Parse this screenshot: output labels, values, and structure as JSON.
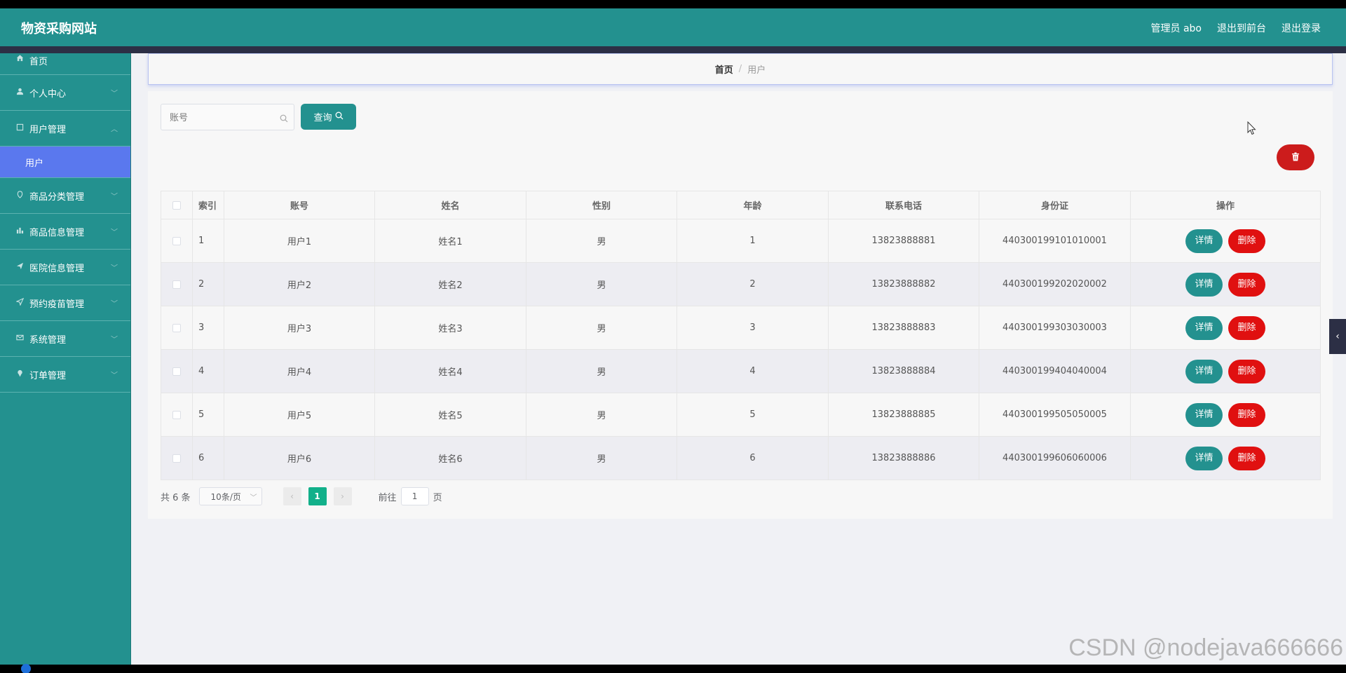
{
  "header": {
    "title": "物资采购网站",
    "admin_label": "管理员 abo",
    "back_front": "退出到前台",
    "logout": "退出登录"
  },
  "sidebar": {
    "items": [
      {
        "label": "首页",
        "icon": "home-icon"
      },
      {
        "label": "个人中心",
        "icon": "user-icon"
      },
      {
        "label": "用户管理",
        "icon": "square-icon",
        "expanded": true,
        "sub": [
          "用户"
        ]
      },
      {
        "label": "商品分类管理",
        "icon": "tag-icon"
      },
      {
        "label": "商品信息管理",
        "icon": "chart-icon"
      },
      {
        "label": "医院信息管理",
        "icon": "send-icon"
      },
      {
        "label": "预约疫苗管理",
        "icon": "location-icon"
      },
      {
        "label": "系统管理",
        "icon": "mail-icon"
      },
      {
        "label": "订单管理",
        "icon": "pin-icon"
      }
    ],
    "active_sub": "用户",
    "active_color": "#5a78ee"
  },
  "breadcrumb": {
    "home": "首页",
    "separator": "/",
    "current": "用户"
  },
  "search": {
    "placeholder": "账号",
    "query_label": "查询"
  },
  "table": {
    "columns": [
      "索引",
      "账号",
      "姓名",
      "性别",
      "年龄",
      "联系电话",
      "身份证",
      "操作"
    ],
    "rows": [
      {
        "idx": "1",
        "account": "用户1",
        "name": "姓名1",
        "gender": "男",
        "age": "1",
        "phone": "13823888881",
        "id_card": "440300199101010001"
      },
      {
        "idx": "2",
        "account": "用户2",
        "name": "姓名2",
        "gender": "男",
        "age": "2",
        "phone": "13823888882",
        "id_card": "440300199202020002"
      },
      {
        "idx": "3",
        "account": "用户3",
        "name": "姓名3",
        "gender": "男",
        "age": "3",
        "phone": "13823888883",
        "id_card": "440300199303030003"
      },
      {
        "idx": "4",
        "account": "用户4",
        "name": "姓名4",
        "gender": "男",
        "age": "4",
        "phone": "13823888884",
        "id_card": "440300199404040004"
      },
      {
        "idx": "5",
        "account": "用户5",
        "name": "姓名5",
        "gender": "男",
        "age": "5",
        "phone": "13823888885",
        "id_card": "440300199505050005"
      },
      {
        "idx": "6",
        "account": "用户6",
        "name": "姓名6",
        "gender": "男",
        "age": "6",
        "phone": "13823888886",
        "id_card": "440300199606060006"
      }
    ],
    "detail_label": "详情",
    "delete_label": "删除"
  },
  "pagination": {
    "total": "共 6 条",
    "page_size": "10条/页",
    "current_page": "1",
    "goto_prefix": "前往",
    "goto_value": "1",
    "goto_suffix": "页"
  },
  "watermark": "CSDN @nodejava666666",
  "colors": {
    "primary": "#23918f",
    "danger": "#e01010",
    "active_page": "#12b08a"
  }
}
